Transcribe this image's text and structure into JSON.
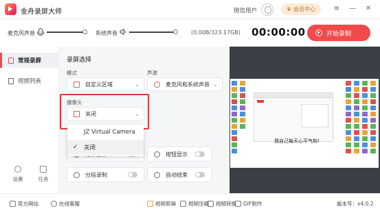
{
  "app": {
    "title": "金舟录屏大师"
  },
  "header": {
    "wechat_user": "微信用户",
    "vip_label": "会员中心"
  },
  "audio": {
    "mic_label": "麦克风声音",
    "system_label": "系统声音",
    "storage": "(0.00B/323.17GB)",
    "timer": "00:00:00",
    "start_label": "开始录制"
  },
  "sidebar": {
    "items": [
      {
        "label": "常规录屏"
      },
      {
        "label": "视频列表"
      }
    ],
    "bottom": [
      {
        "label": "设置"
      },
      {
        "label": "任务"
      }
    ]
  },
  "settings": {
    "section_title": "录屏选择",
    "mode_label": "模式",
    "mode_value": "自定义区域",
    "source_label": "声源",
    "source_value": "麦克风和系统声音",
    "camera_label": "摄像头",
    "camera_value": "关闭",
    "camera_options": [
      "JZ Virtual Camera",
      "关闭"
    ],
    "row1_left": "分屏显示",
    "row1_right": "按钮显示",
    "row2_left": "分段录制",
    "row2_right": "自动结束"
  },
  "preview": {
    "caption": "我自己每天心平气和!"
  },
  "footer": {
    "website": "官方网站",
    "support": "在线客服",
    "tools": [
      "视频剪辑",
      "视频压缩",
      "视频转换",
      "GIF制作"
    ],
    "version": "版本号：v4.0.2"
  },
  "colors": {
    "accent": "#f04a4a",
    "vip_bg": "#fdebd6",
    "preview_bg": "#3b3f46"
  }
}
